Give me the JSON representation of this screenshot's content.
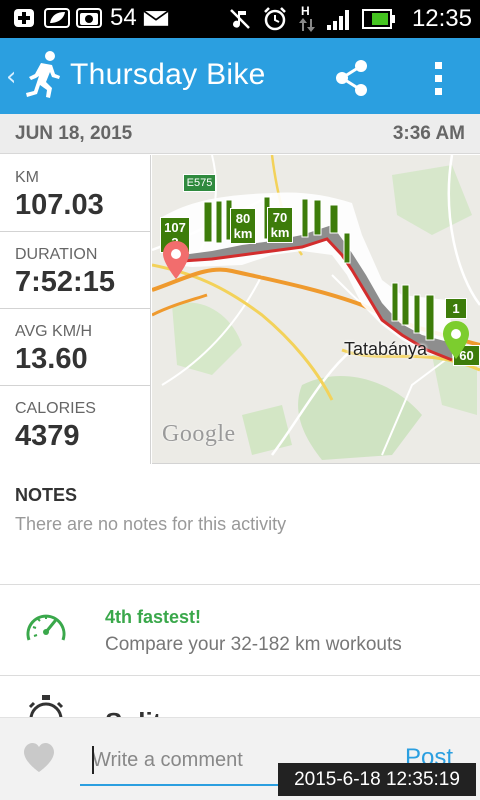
{
  "status_bar": {
    "notification_count": "54",
    "time": "12:35",
    "network_type": "H",
    "icons": [
      "add-box-icon",
      "leaf-icon",
      "camera-icon",
      "mail-icon",
      "muted-icon",
      "alarm-icon",
      "data-arrows-icon",
      "signal-icon",
      "battery-icon"
    ]
  },
  "app_bar": {
    "title": "Thursday Bike",
    "icons": [
      "back-chevron-icon",
      "runner-icon",
      "share-icon",
      "overflow-menu-icon"
    ]
  },
  "activity": {
    "date": "JUN 18, 2015",
    "time": "3:36 AM"
  },
  "stats": [
    {
      "label": "KM",
      "value": "107.03"
    },
    {
      "label": "DURATION",
      "value": "7:52:15"
    },
    {
      "label": "AVG KM/H",
      "value": "13.60"
    },
    {
      "label": "CALORIES",
      "value": "4379"
    }
  ],
  "map": {
    "road_badge": "E575",
    "city": "Tatabánya",
    "attribution": "Google",
    "km_markers": [
      {
        "line1": "107",
        "line2": "3"
      },
      {
        "line1": "80",
        "line2": "km"
      },
      {
        "line1": "70",
        "line2": "km"
      },
      {
        "line1": "1",
        "line2": ""
      },
      {
        "line1": "",
        "line2": "60"
      }
    ]
  },
  "notes": {
    "title": "NOTES",
    "body": "There are no notes for this activity"
  },
  "achievement": {
    "title": "4th fastest!",
    "subtitle": "Compare your 32-182 km workouts"
  },
  "splits": {
    "label": "Splits"
  },
  "comment": {
    "placeholder": "Write a comment",
    "post_label": "Post"
  },
  "timestamp_overlay": "2015-6-18 12:35:19",
  "colors": {
    "app_bar": "#2b9fe0",
    "accent_green": "#3aa84b",
    "marker_green": "#3d7c0a",
    "route_red": "#d32d2d"
  }
}
